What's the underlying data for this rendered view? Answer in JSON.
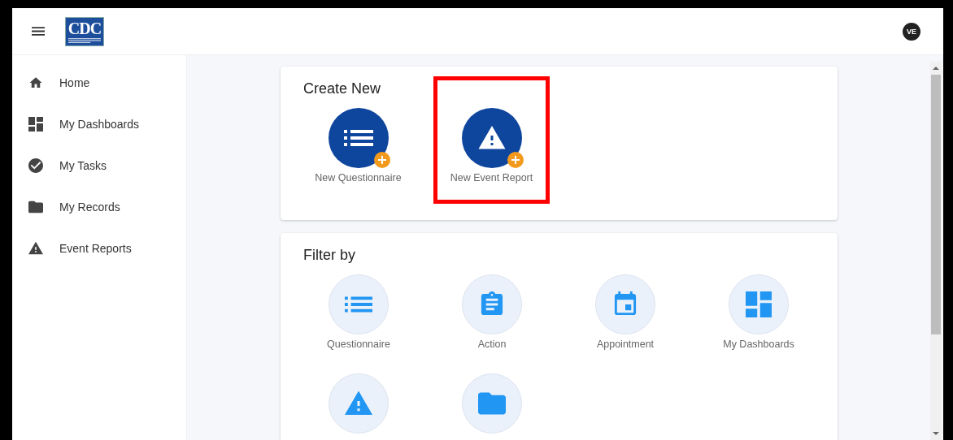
{
  "header": {
    "logo_text": "CDC",
    "avatar": "VE"
  },
  "sidebar": {
    "items": [
      {
        "label": "Home"
      },
      {
        "label": "My Dashboards"
      },
      {
        "label": "My Tasks"
      },
      {
        "label": "My Records"
      },
      {
        "label": "Event Reports"
      }
    ]
  },
  "create_new": {
    "title": "Create New",
    "items": [
      {
        "label": "New Questionnaire",
        "highlighted": false
      },
      {
        "label": "New Event Report",
        "highlighted": true
      }
    ]
  },
  "filter_by": {
    "title": "Filter by",
    "items": [
      {
        "kind": "list",
        "label": "Questionnaire"
      },
      {
        "kind": "clip",
        "label": "Action"
      },
      {
        "kind": "cal",
        "label": "Appointment"
      },
      {
        "kind": "dash",
        "label": "My Dashboards"
      },
      {
        "kind": "warn"
      },
      {
        "kind": "folder"
      }
    ]
  }
}
